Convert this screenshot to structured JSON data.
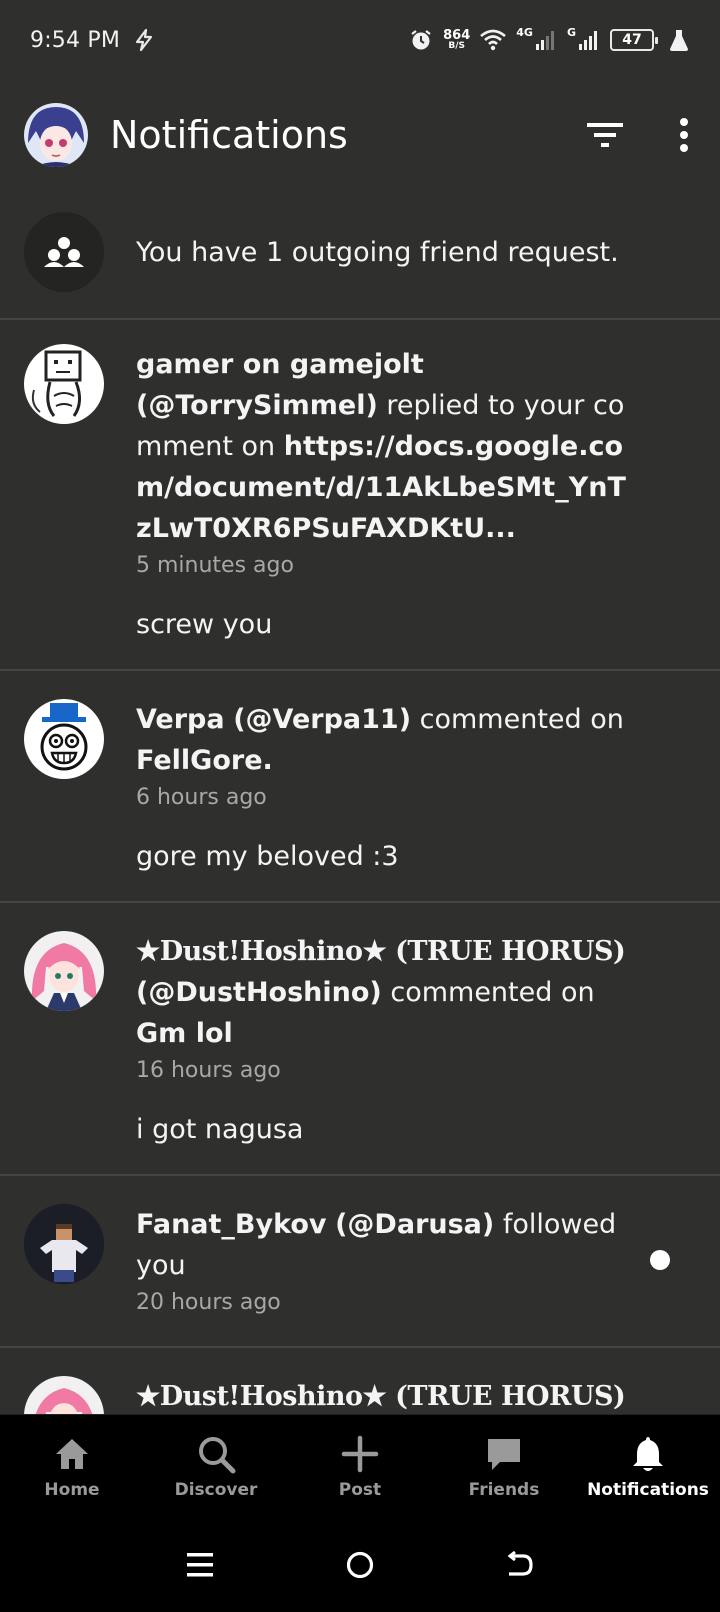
{
  "status_bar": {
    "time": "9:54 PM",
    "speed_value": "864",
    "speed_unit": "B/S",
    "net1": "4G",
    "net2": "G",
    "battery": "47"
  },
  "header": {
    "title": "Notifications"
  },
  "notifications": [
    {
      "friend_request_text": "You have 1 outgoing friend request."
    },
    {
      "user": "gamer on gamejolt",
      "handle": "(@TorrySimmel)",
      "action": " replied to your comment on ",
      "target": "https://docs.google.com/document/d/11AkLbeSMt_YnTzLwT0XR6PSuFAXDKtU...",
      "time": "5 minutes ago",
      "comment": "screw you"
    },
    {
      "user": "Verpa",
      "handle": "(@Verpa11)",
      "action": " commented on ",
      "target": "FellGore.",
      "time": "6 hours ago",
      "comment": "gore my beloved :3"
    },
    {
      "user": "★Dust!Hoshino★ (TRUE HORUS)",
      "handle": "(@DustHoshino)",
      "action": " commented on ",
      "target": "Gm lol",
      "time": "16 hours ago",
      "comment": "i got nagusa"
    },
    {
      "user": "Fanat_Bykov",
      "handle": "(@Darusa)",
      "action": " followed you",
      "time": "20 hours ago"
    },
    {
      "user": "★Dust!Hoshino★ (TRUE HORUS)"
    }
  ],
  "bottom_nav": {
    "items": [
      {
        "label": "Home",
        "icon": "home-icon"
      },
      {
        "label": "Discover",
        "icon": "search-icon"
      },
      {
        "label": "Post",
        "icon": "plus-icon"
      },
      {
        "label": "Friends",
        "icon": "chat-bubble-icon"
      },
      {
        "label": "Notifications",
        "icon": "bell-icon"
      }
    ],
    "active": "Notifications"
  },
  "colors": {
    "background": "#2f2f2d",
    "divider": "#454542",
    "nav_background": "#000000",
    "muted_text": "#a8a8a6"
  }
}
